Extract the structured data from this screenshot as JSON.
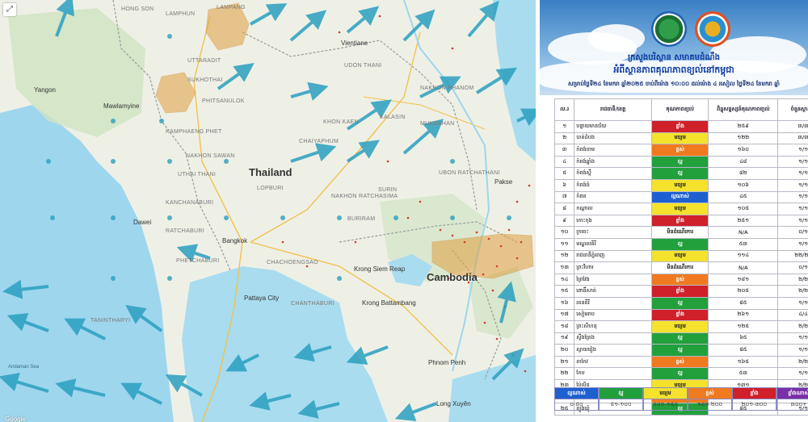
{
  "map": {
    "country_labels": [
      "Thailand",
      "Cambodia"
    ],
    "places": [
      {
        "name": "HONG SON",
        "kind": "prov"
      },
      {
        "name": "LAMPHUN",
        "kind": "prov"
      },
      {
        "name": "LAMPANG",
        "kind": "prov"
      },
      {
        "name": "UTTARADIT",
        "kind": "prov"
      },
      {
        "name": "SUKHOTHAI",
        "kind": "prov"
      },
      {
        "name": "PHITSANULOK",
        "kind": "prov"
      },
      {
        "name": "KAMPHAENG PHET",
        "kind": "prov"
      },
      {
        "name": "NAKHON SAWAN",
        "kind": "prov"
      },
      {
        "name": "UTHAI THANI",
        "kind": "prov"
      },
      {
        "name": "LOPBURI",
        "kind": "prov"
      },
      {
        "name": "KANCHANABURI",
        "kind": "prov"
      },
      {
        "name": "RATCHABURI",
        "kind": "prov"
      },
      {
        "name": "PHETCHABURI",
        "kind": "prov"
      },
      {
        "name": "KHON KAEN",
        "kind": "prov"
      },
      {
        "name": "CHAIYAPHUM",
        "kind": "prov"
      },
      {
        "name": "NAKHON RATCHASIMA",
        "kind": "prov"
      },
      {
        "name": "BURIRAM",
        "kind": "prov"
      },
      {
        "name": "SURIN",
        "kind": "prov"
      },
      {
        "name": "UDON THANI",
        "kind": "prov"
      },
      {
        "name": "KALASIN",
        "kind": "prov"
      },
      {
        "name": "MUKDAHAN",
        "kind": "prov"
      },
      {
        "name": "NAKHON PHANOM",
        "kind": "prov"
      },
      {
        "name": "UBON RATCHATHANI",
        "kind": "prov"
      },
      {
        "name": "CHACHOENGSAO",
        "kind": "prov"
      },
      {
        "name": "CHANTHABURI",
        "kind": "prov"
      },
      {
        "name": "TANINTHARYI",
        "kind": "prov"
      },
      {
        "name": "Vientiane",
        "kind": "city"
      },
      {
        "name": "Bangkok",
        "kind": "city"
      },
      {
        "name": "Pattaya City",
        "kind": "city"
      },
      {
        "name": "Krong Siem Reap",
        "kind": "city"
      },
      {
        "name": "Krong Battambang",
        "kind": "city"
      },
      {
        "name": "Phnom Penh",
        "kind": "city"
      },
      {
        "name": "Long Xuyên",
        "kind": "city"
      },
      {
        "name": "Mawlamyine",
        "kind": "city"
      },
      {
        "name": "Yangon",
        "kind": "city"
      },
      {
        "name": "Dawei",
        "kind": "city"
      },
      {
        "name": "Pakse",
        "kind": "city"
      },
      {
        "name": "Andaman Sea",
        "kind": "sea"
      },
      {
        "name": "Google",
        "kind": "glogo"
      }
    ],
    "hotspot_color": "#e0a040",
    "arrow_color": "#2a9fc0"
  },
  "panel": {
    "title_line1": "ក្រសួងបរិស្ថាន សមាគមដំណឹង",
    "title_line2": "អំពីស្ថានភាពគុណភាពខ្យល់នៅកម្ពុជា",
    "subtitle": "សម្រាប់ថ្ងៃទី២៤ ខែមករា ឆ្នាំ២០២៥ ចាប់ពីម៉ោង ១០:០០ ដល់ម៉ោង ៤ រសៀល ថ្ងៃទី២៤ ខែមករា ឆ្នាំ",
    "headers": [
      "ល.រ",
      "រាជធានី/ខេត្ត",
      "គុណភាពខ្យល់",
      "ពិន្ទុសន្ទស្សន៍គុណភាពខ្យល់",
      "ចំនួនស្ថានីយ៍"
    ],
    "rows": [
      {
        "n": "១",
        "name": "បន្ទាយមានជ័យ",
        "quality": "ខ្លាំង",
        "color": "#d0202a",
        "index": "២៥៩",
        "st": "៣/៣"
      },
      {
        "n": "២",
        "name": "បាត់ដំបង",
        "quality": "មធ្យម",
        "color": "#f4e22c",
        "index": "១២២",
        "st": "៣/៣"
      },
      {
        "n": "៣",
        "name": "កំពង់ចាម",
        "quality": "ខ្ពស់",
        "color": "#f07a20",
        "index": "១៦០",
        "st": "១/១"
      },
      {
        "n": "៤",
        "name": "កំពង់ឆ្នាំង",
        "quality": "ល្អ",
        "color": "#21a03c",
        "index": "៤៨",
        "st": "១/១"
      },
      {
        "n": "៥",
        "name": "កំពង់ស្ពឺ",
        "quality": "ល្អ",
        "color": "#21a03c",
        "index": "៨២",
        "st": "១/១"
      },
      {
        "n": "៦",
        "name": "កំពង់ធំ",
        "quality": "មធ្យម",
        "color": "#f4e22c",
        "index": "១០៦",
        "st": "១/១"
      },
      {
        "n": "៧",
        "name": "កំពត",
        "quality": "ល្អណាស់",
        "color": "#1e60d0",
        "index": "៤៥",
        "st": "១/១"
      },
      {
        "n": "៨",
        "name": "កណ្ដាល",
        "quality": "មធ្យម",
        "color": "#f4e22c",
        "index": "១០៥",
        "st": "១/១"
      },
      {
        "n": "៩",
        "name": "កោះកុង",
        "quality": "ខ្លាំង",
        "color": "#d0202a",
        "index": "២៥១",
        "st": "១/១"
      },
      {
        "n": "១០",
        "name": "ក្រចេះ",
        "quality": "មិនដំណើរការ",
        "color": "#ffffff",
        "index": "N/A",
        "st": "០/១"
      },
      {
        "n": "១១",
        "name": "មណ្ឌលគិរី",
        "quality": "ល្អ",
        "color": "#21a03c",
        "index": "៥៣",
        "st": "១/១"
      },
      {
        "n": "១២",
        "name": "រាជធានីភ្នំពេញ",
        "quality": "មធ្យម",
        "color": "#f4e22c",
        "index": "១១៤",
        "st": "២២/២៤"
      },
      {
        "n": "១៣",
        "name": "ព្រះវិហារ",
        "quality": "មិនដំណើរការ",
        "color": "#ffffff",
        "index": "N/A",
        "st": "០/១"
      },
      {
        "n": "១៤",
        "name": "ព្រៃវែង",
        "quality": "ខ្ពស់",
        "color": "#f07a20",
        "index": "១៨១",
        "st": "២/២"
      },
      {
        "n": "១៥",
        "name": "ពោធិ៍សាត់",
        "quality": "ខ្លាំង",
        "color": "#d0202a",
        "index": "២០៥",
        "st": "២/២"
      },
      {
        "n": "១៦",
        "name": "រតនគិរី",
        "quality": "ល្អ",
        "color": "#21a03c",
        "index": "៨៥",
        "st": "១/១"
      },
      {
        "n": "១៧",
        "name": "សៀមរាប",
        "quality": "ខ្លាំង",
        "color": "#d0202a",
        "index": "២៦១",
        "st": "៤/៤"
      },
      {
        "n": "១៨",
        "name": "ព្រះសីហនុ",
        "quality": "មធ្យម",
        "color": "#f4e22c",
        "index": "១២៥",
        "st": "២/២"
      },
      {
        "n": "១៩",
        "name": "ស្ទឹងត្រែង",
        "quality": "ល្អ",
        "color": "#21a03c",
        "index": "៦៥",
        "st": "១/១"
      },
      {
        "n": "២០",
        "name": "ស្វាយរៀង",
        "quality": "ល្អ",
        "color": "#21a03c",
        "index": "៨៥",
        "st": "១/១"
      },
      {
        "n": "២១",
        "name": "តាកែវ",
        "quality": "ខ្ពស់",
        "color": "#f07a20",
        "index": "១៦៥",
        "st": "២/២"
      },
      {
        "n": "២២",
        "name": "កែប",
        "quality": "ល្អ",
        "color": "#21a03c",
        "index": "៥៣",
        "st": "១/១"
      },
      {
        "n": "២៣",
        "name": "ប៉ៃលិន",
        "quality": "មធ្យម",
        "color": "#f4e22c",
        "index": "១៣១",
        "st": "២/២"
      },
      {
        "n": "២៤",
        "name": "ឧត្ដរមានជ័យ",
        "quality": "ខ្ពស់",
        "color": "#f07a20",
        "index": "១៥៥",
        "st": "២/២"
      },
      {
        "n": "២៥",
        "name": "ត្បូងឃ្មុំ",
        "quality": "ល្អ",
        "color": "#21a03c",
        "index": "៨៥",
        "st": "១/១"
      }
    ],
    "legend": [
      {
        "label": "ល្អណាស់",
        "range": "០-៥០",
        "color": "#1e60d0"
      },
      {
        "label": "ល្អ",
        "range": "៥១-១០០",
        "color": "#21a03c"
      },
      {
        "label": "មធ្យម",
        "range": "១០១-១៥០",
        "color": "#f4e22c"
      },
      {
        "label": "ខ្ពស់",
        "range": "១៥១-២០០",
        "color": "#f07a20"
      },
      {
        "label": "ខ្លាំង",
        "range": "២០១-៣០០",
        "color": "#d0202a"
      },
      {
        "label": "ខ្លាំងណាស់",
        "range": "៣០០+",
        "color": "#7a30a8"
      }
    ]
  }
}
